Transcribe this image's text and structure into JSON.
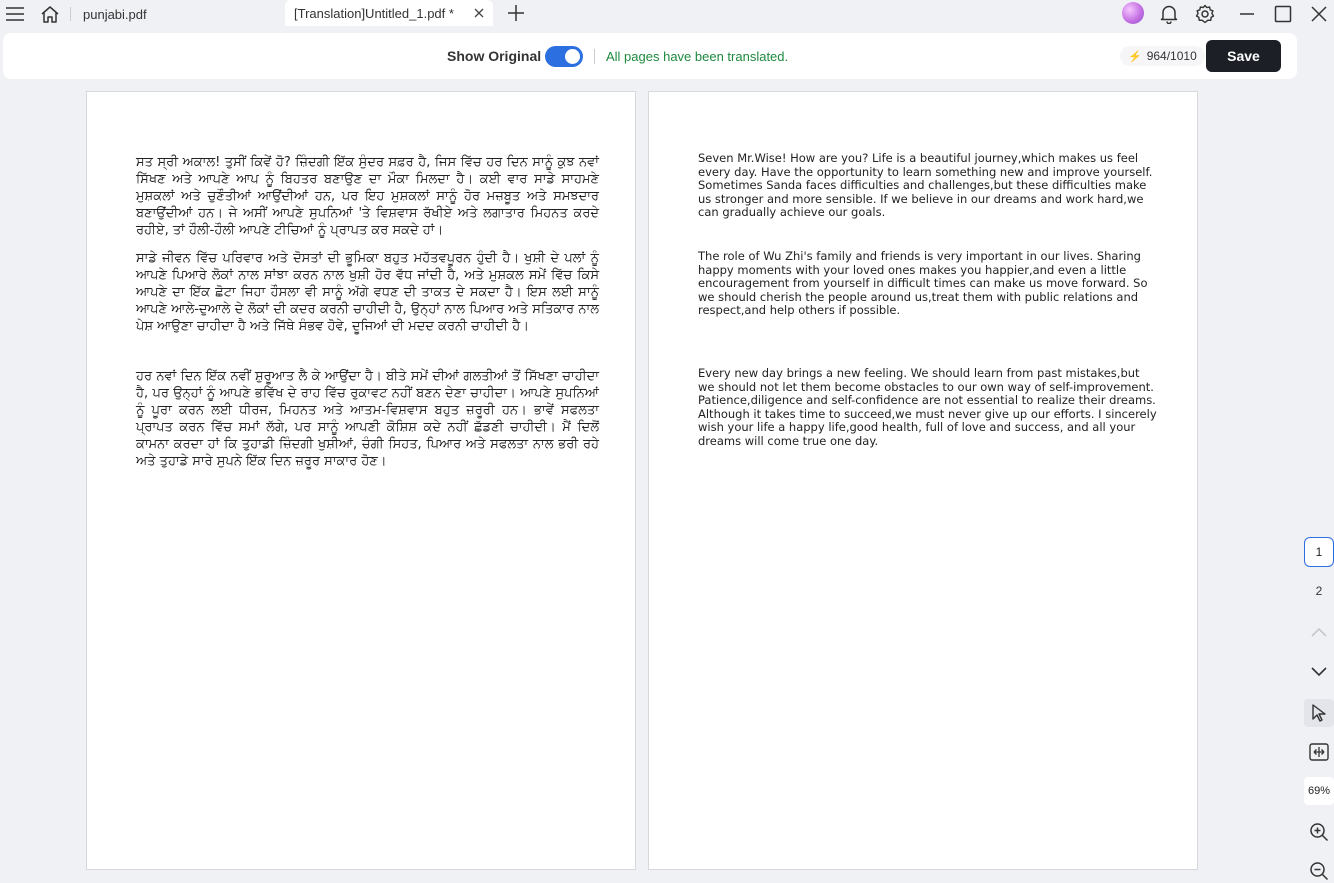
{
  "window": {
    "tabs": [
      {
        "label": "punjabi.pdf"
      },
      {
        "label": "[Translation]Untitled_1.pdf *"
      }
    ]
  },
  "toolbar": {
    "show_original_label": "Show Original",
    "show_original_on": true,
    "status": "All pages have been translated.",
    "credits": "964/1010",
    "save_label": "Save"
  },
  "original": {
    "paragraphs": [
      "ਸਤ ਸ੍ਰੀ ਅਕਾਲ! ਤੁਸੀਂ ਕਿਵੇਂ ਹੋ? ਜ਼ਿੰਦਗੀ ਇੱਕ ਸੁੰਦਰ ਸਫ਼ਰ ਹੈ, ਜਿਸ ਵਿੱਚ ਹਰ ਦਿਨ ਸਾਨੂੰ ਕੁਝ ਨਵਾਂ ਸਿੱਖਣ ਅਤੇ ਆਪਣੇ ਆਪ ਨੂੰ ਬਿਹਤਰ ਬਣਾਉਣ ਦਾ ਮੌਕਾ ਮਿਲਦਾ ਹੈ। ਕਈ ਵਾਰ ਸਾਡੇ ਸਾਹਮਣੇ ਮੁਸ਼ਕਲਾਂ ਅਤੇ ਚੁਣੌਤੀਆਂ ਆਉਂਦੀਆਂ ਹਨ, ਪਰ ਇਹ ਮੁਸ਼ਕਲਾਂ ਸਾਨੂੰ ਹੋਰ ਮਜ਼ਬੂਤ ਅਤੇ ਸਮਝਦਾਰ ਬਣਾਉਂਦੀਆਂ ਹਨ। ਜੇ ਅਸੀਂ ਆਪਣੇ ਸੁਪਨਿਆਂ 'ਤੇ ਵਿਸ਼ਵਾਸ ਰੱਖੀਏ ਅਤੇ ਲਗਾਤਾਰ ਮਿਹਨਤ ਕਰਦੇ ਰਹੀਏ, ਤਾਂ ਹੌਲੀ-ਹੌਲੀ ਆਪਣੇ ਟੀਚਿਆਂ ਨੂੰ ਪ੍ਰਾਪਤ ਕਰ ਸਕਦੇ ਹਾਂ।",
      "ਸਾਡੇ ਜੀਵਨ ਵਿੱਚ ਪਰਿਵਾਰ ਅਤੇ ਦੋਸਤਾਂ ਦੀ ਭੂਮਿਕਾ ਬਹੁਤ ਮਹੱਤਵਪੂਰਨ ਹੁੰਦੀ ਹੈ। ਖੁਸ਼ੀ ਦੇ ਪਲਾਂ ਨੂੰ ਆਪਣੇ ਪਿਆਰੇ ਲੋਕਾਂ ਨਾਲ ਸਾਂਝਾ ਕਰਨ ਨਾਲ ਖੁਸ਼ੀ ਹੋਰ ਵੱਧ ਜਾਂਦੀ ਹੈ, ਅਤੇ ਮੁਸ਼ਕਲ ਸਮੇਂ ਵਿੱਚ ਕਿਸੇ ਆਪਣੇ ਦਾ ਇੱਕ ਛੋਟਾ ਜਿਹਾ ਹੌਸਲਾ ਵੀ ਸਾਨੂੰ ਅੱਗੇ ਵਧਣ ਦੀ ਤਾਕਤ ਦੇ ਸਕਦਾ ਹੈ। ਇਸ ਲਈ ਸਾਨੂੰ ਆਪਣੇ ਆਲੇ-ਦੁਆਲੇ ਦੇ ਲੋਕਾਂ ਦੀ ਕਦਰ ਕਰਨੀ ਚਾਹੀਦੀ ਹੈ, ਉਨ੍ਹਾਂ ਨਾਲ ਪਿਆਰ ਅਤੇ ਸਤਿਕਾਰ ਨਾਲ ਪੇਸ਼ ਆਉਣਾ ਚਾਹੀਦਾ ਹੈ ਅਤੇ ਜਿੱਥੇ ਸੰਭਵ ਹੋਵੇ, ਦੂਜਿਆਂ ਦੀ ਮਦਦ ਕਰਨੀ ਚਾਹੀਦੀ ਹੈ।",
      "ਹਰ ਨਵਾਂ ਦਿਨ ਇੱਕ ਨਵੀਂ ਸ਼ੁਰੂਆਤ ਲੈ ਕੇ ਆਉਂਦਾ ਹੈ। ਬੀਤੇ ਸਮੇਂ ਦੀਆਂ ਗਲਤੀਆਂ ਤੋਂ ਸਿੱਖਣਾ ਚਾਹੀਦਾ ਹੈ, ਪਰ ਉਨ੍ਹਾਂ ਨੂੰ ਆਪਣੇ ਭਵਿੱਖ ਦੇ ਰਾਹ ਵਿੱਚ ਰੁਕਾਵਟ ਨਹੀਂ ਬਣਨ ਦੇਣਾ ਚਾਹੀਦਾ। ਆਪਣੇ ਸੁਪਨਿਆਂ ਨੂੰ ਪੂਰਾ ਕਰਨ ਲਈ ਧੀਰਜ, ਮਿਹਨਤ ਅਤੇ ਆਤਮ-ਵਿਸ਼ਵਾਸ ਬਹੁਤ ਜ਼ਰੂਰੀ ਹਨ। ਭਾਵੇਂ ਸਫਲਤਾ ਪ੍ਰਾਪਤ ਕਰਨ ਵਿੱਚ ਸਮਾਂ ਲੱਗੇ, ਪਰ ਸਾਨੂੰ ਆਪਣੀ ਕੋਸ਼ਿਸ਼ ਕਦੇ ਨਹੀਂ ਛੱਡਣੀ ਚਾਹੀਦੀ। ਮੈਂ ਦਿਲੋਂ ਕਾਮਨਾ ਕਰਦਾ ਹਾਂ ਕਿ ਤੁਹਾਡੀ ਜ਼ਿੰਦਗੀ ਖੁਸ਼ੀਆਂ, ਚੰਗੀ ਸਿਹਤ, ਪਿਆਰ ਅਤੇ ਸਫਲਤਾ ਨਾਲ ਭਰੀ ਰਹੇ ਅਤੇ ਤੁਹਾਡੇ ਸਾਰੇ ਸੁਪਨੇ ਇੱਕ ਦਿਨ ਜ਼ਰੂਰ ਸਾਕਾਰ ਹੋਣ।"
    ]
  },
  "translation": {
    "paragraphs": [
      "Seven Mr.Wise! How are you? Life is a beautiful journey,which makes us feel every day. Have the opportunity to learn something new and improve yourself. Sometimes Sanda faces difficulties and challenges,but these difficulties make us stronger and more sensible. If we believe in our dreams and work hard,we can gradually achieve our goals.",
      "The role of Wu Zhi's family and friends is very important in our lives. Sharing happy moments with your loved ones makes you happier,and even a little encouragement from yourself in difficult times can make us move forward. So we should cherish the people around us,treat them with public relations and respect,and help others if possible.",
      "Every new day brings a new feeling. We should learn from past mistakes,but we should not let them become obstacles to our own way of self-improvement. Patience,diligence and self-confidence are not essential to realize their dreams. Although it takes time to succeed,we must never give up our efforts. I sincerely wish your life a happy life,good health, full of love and success, and all your dreams will come true one day."
    ]
  },
  "pager": {
    "current": "1",
    "next": "2",
    "zoom": "69%"
  },
  "colors": {
    "accent": "#2c6fe0",
    "success": "#1e8a3e",
    "save_bg": "#1c1f26"
  }
}
